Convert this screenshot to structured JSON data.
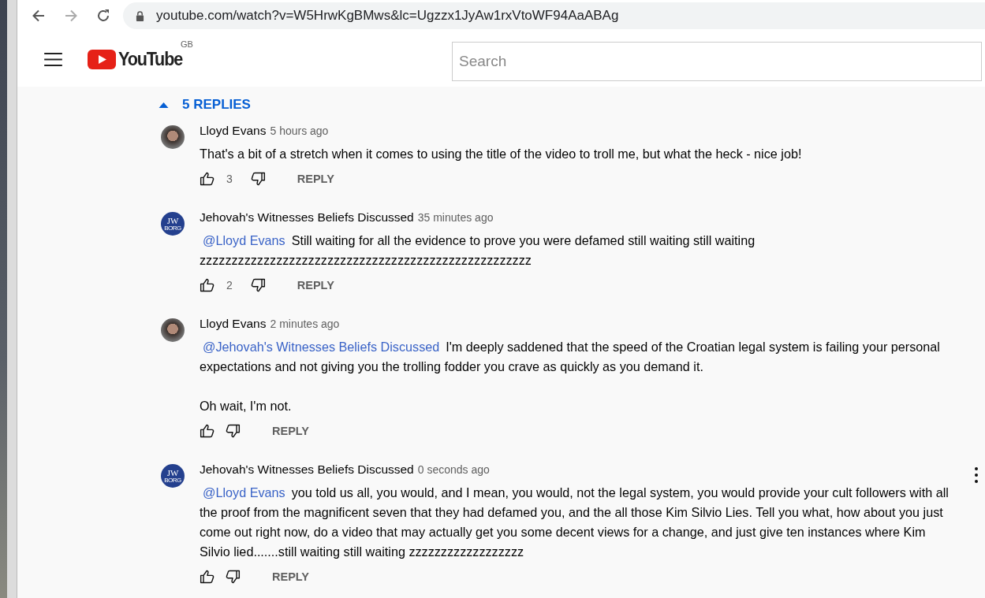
{
  "browser": {
    "url": "youtube.com/watch?v=W5HrwKgBMws&lc=Ugzzx1JyAw1rxVtoWF94AaABAg"
  },
  "header": {
    "logo": "YouTube",
    "region": "GB",
    "search": {
      "placeholder": "Search"
    }
  },
  "replies_toggle": {
    "label": "5 REPLIES",
    "expanded": true
  },
  "comments": [
    {
      "author": "Lloyd Evans",
      "time": "5 hours ago",
      "avatar": {
        "kind": "photo"
      },
      "paragraphs": [
        "That's a bit of a stretch when it comes to using the title of the video to troll me, but what the heck - nice job!"
      ],
      "likes": "3",
      "reply": "REPLY",
      "menu": false
    },
    {
      "author": "Jehovah's Witnesses Beliefs Discussed",
      "time": "35 minutes ago",
      "avatar": {
        "kind": "logo",
        "lines": [
          "JW",
          "BORG"
        ]
      },
      "mention": "@Lloyd Evans",
      "paragraphs": [
        "Still waiting for all the evidence to prove you were defamed still waiting still waiting zzzzzzzzzzzzzzzzzzzzzzzzzzzzzzzzzzzzzzzzzzzzzzzzzzzz"
      ],
      "likes": "2",
      "reply": "REPLY",
      "menu": false
    },
    {
      "author": "Lloyd Evans",
      "time": "2 minutes ago",
      "avatar": {
        "kind": "photo"
      },
      "mention": "@Jehovah's Witnesses Beliefs Discussed",
      "paragraphs": [
        "I'm deeply saddened that the speed of the Croatian legal system is failing your personal expectations and not giving you the trolling fodder you crave as quickly as you demand it.",
        "Oh wait, I'm not."
      ],
      "reply": "REPLY",
      "menu": false
    },
    {
      "author": "Jehovah's Witnesses Beliefs Discussed",
      "time": "0 seconds ago",
      "avatar": {
        "kind": "logo",
        "lines": [
          "JW",
          "BORG"
        ]
      },
      "mention": "@Lloyd Evans",
      "paragraphs": [
        "you told us all, you would, and I mean, you would, not the legal system, you would provide your cult followers with all the proof from the magnificent seven that they had defamed you, and the all those Kim Silvio Lies. Tell you what, how about you just come out right now, do a video that may actually get you some decent views for a change, and just give ten instances where Kim Silvio lied.......still waiting still waiting zzzzzzzzzzzzzzzzzz"
      ],
      "reply": "REPLY",
      "menu": true
    }
  ]
}
